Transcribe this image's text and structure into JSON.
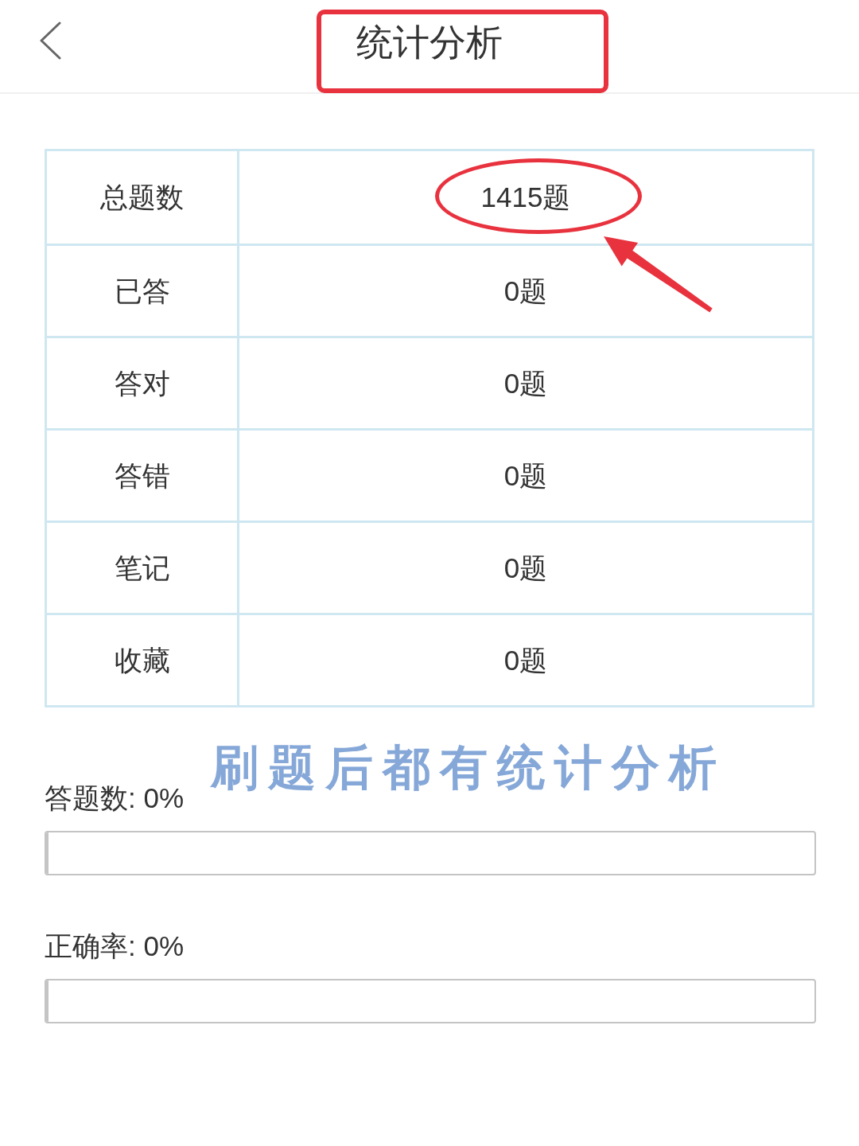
{
  "header": {
    "title": "统计分析",
    "highlighted": true
  },
  "stats_table": {
    "rows": [
      {
        "label": "总题数",
        "value": "1415题",
        "highlighted": true
      },
      {
        "label": "已答",
        "value": "0题",
        "highlighted": false
      },
      {
        "label": "答对",
        "value": "0题",
        "highlighted": false
      },
      {
        "label": "答错",
        "value": "0题",
        "highlighted": false
      },
      {
        "label": "笔记",
        "value": "0题",
        "highlighted": false
      },
      {
        "label": "收藏",
        "value": "0题",
        "highlighted": false
      }
    ]
  },
  "annotation": {
    "caption": "刷题后都有统计分析"
  },
  "progress": [
    {
      "label": "答题数: 0%",
      "level": 0
    },
    {
      "label": "正确率: 0%",
      "level": 0
    }
  ]
}
